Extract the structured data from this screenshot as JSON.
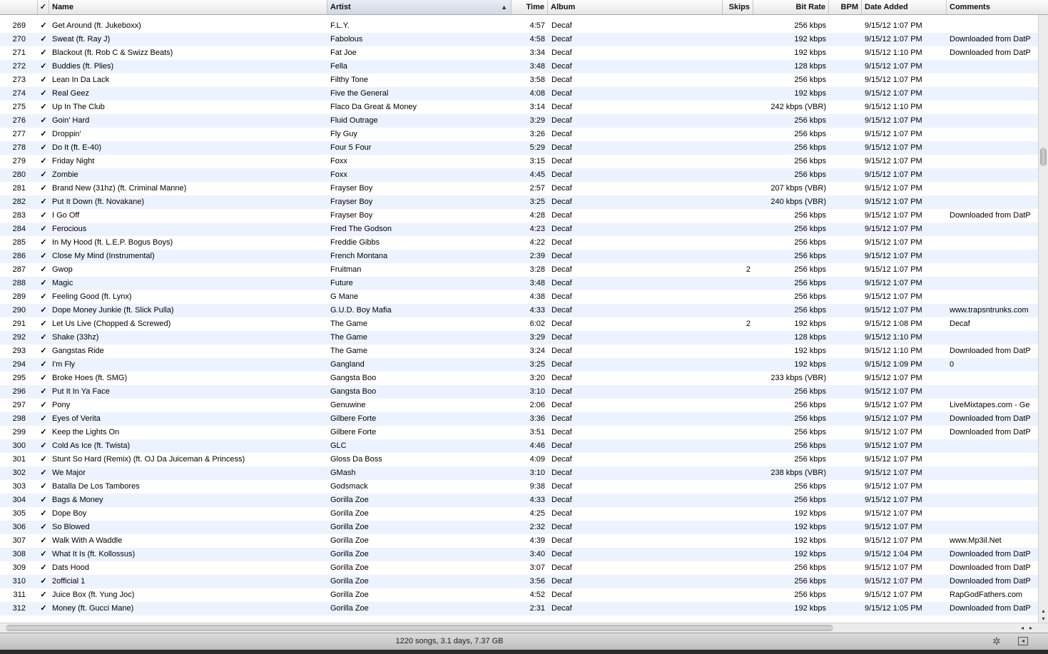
{
  "columns": {
    "check": "✓",
    "name": "Name",
    "artist": "Artist",
    "time": "Time",
    "album": "Album",
    "skips": "Skips",
    "bitrate": "Bit Rate",
    "bpm": "BPM",
    "date_added": "Date Added",
    "comments": "Comments",
    "sort_arrow": "▲"
  },
  "sorted_column": "artist",
  "rows": [
    {
      "num": "269",
      "check": "✓",
      "name": "Get Around (ft. Jukeboxx)",
      "artist": "F.L.Y.",
      "time": "4:57",
      "album": "Decaf",
      "skips": "",
      "bitrate": "256 kbps",
      "bpm": "",
      "date": "9/15/12 1:07 PM",
      "comments": ""
    },
    {
      "num": "270",
      "check": "✓",
      "name": "Sweat (ft. Ray J)",
      "artist": "Fabolous",
      "time": "4:58",
      "album": "Decaf",
      "skips": "",
      "bitrate": "192 kbps",
      "bpm": "",
      "date": "9/15/12 1:07 PM",
      "comments": "Downloaded from DatP"
    },
    {
      "num": "271",
      "check": "✓",
      "name": "Blackout (ft. Rob C & Swizz Beats)",
      "artist": "Fat Joe",
      "time": "3:34",
      "album": "Decaf",
      "skips": "",
      "bitrate": "192 kbps",
      "bpm": "",
      "date": "9/15/12 1:10 PM",
      "comments": "Downloaded from DatP"
    },
    {
      "num": "272",
      "check": "✓",
      "name": "Buddies (ft. Plies)",
      "artist": "Fella",
      "time": "3:48",
      "album": "Decaf",
      "skips": "",
      "bitrate": "128 kbps",
      "bpm": "",
      "date": "9/15/12 1:07 PM",
      "comments": ""
    },
    {
      "num": "273",
      "check": "✓",
      "name": "Lean In Da Lack",
      "artist": "Filthy Tone",
      "time": "3:58",
      "album": "Decaf",
      "skips": "",
      "bitrate": "256 kbps",
      "bpm": "",
      "date": "9/15/12 1:07 PM",
      "comments": ""
    },
    {
      "num": "274",
      "check": "✓",
      "name": "Real Geez",
      "artist": "Five the General",
      "time": "4:08",
      "album": "Decaf",
      "skips": "",
      "bitrate": "192 kbps",
      "bpm": "",
      "date": "9/15/12 1:07 PM",
      "comments": ""
    },
    {
      "num": "275",
      "check": "✓",
      "name": "Up In The Club",
      "artist": "Flaco Da Great & Money",
      "time": "3:14",
      "album": "Decaf",
      "skips": "",
      "bitrate": "242 kbps (VBR)",
      "bpm": "",
      "date": "9/15/12 1:10 PM",
      "comments": ""
    },
    {
      "num": "276",
      "check": "✓",
      "name": "Goin' Hard",
      "artist": "Fluid Outrage",
      "time": "3:29",
      "album": "Decaf",
      "skips": "",
      "bitrate": "256 kbps",
      "bpm": "",
      "date": "9/15/12 1:07 PM",
      "comments": ""
    },
    {
      "num": "277",
      "check": "✓",
      "name": "Droppin'",
      "artist": "Fly Guy",
      "time": "3:26",
      "album": "Decaf",
      "skips": "",
      "bitrate": "256 kbps",
      "bpm": "",
      "date": "9/15/12 1:07 PM",
      "comments": ""
    },
    {
      "num": "278",
      "check": "✓",
      "name": "Do It (ft. E-40)",
      "artist": "Four 5 Four",
      "time": "5:29",
      "album": "Decaf",
      "skips": "",
      "bitrate": "256 kbps",
      "bpm": "",
      "date": "9/15/12 1:07 PM",
      "comments": ""
    },
    {
      "num": "279",
      "check": "✓",
      "name": "Friday Night",
      "artist": "Foxx",
      "time": "3:15",
      "album": "Decaf",
      "skips": "",
      "bitrate": "256 kbps",
      "bpm": "",
      "date": "9/15/12 1:07 PM",
      "comments": ""
    },
    {
      "num": "280",
      "check": "✓",
      "name": "Zombie",
      "artist": "Foxx",
      "time": "4:45",
      "album": "Decaf",
      "skips": "",
      "bitrate": "256 kbps",
      "bpm": "",
      "date": "9/15/12 1:07 PM",
      "comments": ""
    },
    {
      "num": "281",
      "check": "✓",
      "name": "Brand New (31hz) (ft. Criminal Manne)",
      "artist": "Frayser Boy",
      "time": "2:57",
      "album": "Decaf",
      "skips": "",
      "bitrate": "207 kbps (VBR)",
      "bpm": "",
      "date": "9/15/12 1:07 PM",
      "comments": ""
    },
    {
      "num": "282",
      "check": "✓",
      "name": "Put It Down (ft. Novakane)",
      "artist": "Frayser Boy",
      "time": "3:25",
      "album": "Decaf",
      "skips": "",
      "bitrate": "240 kbps (VBR)",
      "bpm": "",
      "date": "9/15/12 1:07 PM",
      "comments": ""
    },
    {
      "num": "283",
      "check": "✓",
      "name": "I Go Off",
      "artist": "Frayser Boy",
      "time": "4:28",
      "album": "Decaf",
      "skips": "",
      "bitrate": "256 kbps",
      "bpm": "",
      "date": "9/15/12 1:07 PM",
      "comments": "Downloaded from DatP"
    },
    {
      "num": "284",
      "check": "✓",
      "name": "Ferocious",
      "artist": "Fred The Godson",
      "time": "4:23",
      "album": "Decaf",
      "skips": "",
      "bitrate": "256 kbps",
      "bpm": "",
      "date": "9/15/12 1:07 PM",
      "comments": ""
    },
    {
      "num": "285",
      "check": "✓",
      "name": "In My Hood (ft. L.E.P. Bogus Boys)",
      "artist": "Freddie Gibbs",
      "time": "4:22",
      "album": "Decaf",
      "skips": "",
      "bitrate": "256 kbps",
      "bpm": "",
      "date": "9/15/12 1:07 PM",
      "comments": ""
    },
    {
      "num": "286",
      "check": "✓",
      "name": "Close My Mind (Instrumental)",
      "artist": "French Montana",
      "time": "2:39",
      "album": "Decaf",
      "skips": "",
      "bitrate": "256 kbps",
      "bpm": "",
      "date": "9/15/12 1:07 PM",
      "comments": ""
    },
    {
      "num": "287",
      "check": "✓",
      "name": "Gwop",
      "artist": "Fruitman",
      "time": "3:28",
      "album": "Decaf",
      "skips": "2",
      "bitrate": "256 kbps",
      "bpm": "",
      "date": "9/15/12 1:07 PM",
      "comments": ""
    },
    {
      "num": "288",
      "check": "✓",
      "name": "Magic",
      "artist": "Future",
      "time": "3:48",
      "album": "Decaf",
      "skips": "",
      "bitrate": "256 kbps",
      "bpm": "",
      "date": "9/15/12 1:07 PM",
      "comments": ""
    },
    {
      "num": "289",
      "check": "✓",
      "name": "Feeling Good (ft. Lynx)",
      "artist": "G Mane",
      "time": "4:38",
      "album": "Decaf",
      "skips": "",
      "bitrate": "256 kbps",
      "bpm": "",
      "date": "9/15/12 1:07 PM",
      "comments": ""
    },
    {
      "num": "290",
      "check": "✓",
      "name": "Dope Money Junkie (ft. Slick Pulla)",
      "artist": "G.U.D. Boy Mafia",
      "time": "4:33",
      "album": "Decaf",
      "skips": "",
      "bitrate": "256 kbps",
      "bpm": "",
      "date": "9/15/12 1:07 PM",
      "comments": "www.trapsntrunks.com"
    },
    {
      "num": "291",
      "check": "✓",
      "name": "Let Us Live (Chopped & Screwed)",
      "artist": "The Game",
      "time": "6:02",
      "album": "Decaf",
      "skips": "2",
      "bitrate": "192 kbps",
      "bpm": "",
      "date": "9/15/12 1:08 PM",
      "comments": "Decaf"
    },
    {
      "num": "292",
      "check": "✓",
      "name": "Shake (33hz)",
      "artist": "The Game",
      "time": "3:29",
      "album": "Decaf",
      "skips": "",
      "bitrate": "128 kbps",
      "bpm": "",
      "date": "9/15/12 1:10 PM",
      "comments": ""
    },
    {
      "num": "293",
      "check": "✓",
      "name": "Gangstas Ride",
      "artist": "The Game",
      "time": "3:24",
      "album": "Decaf",
      "skips": "",
      "bitrate": "192 kbps",
      "bpm": "",
      "date": "9/15/12 1:10 PM",
      "comments": "Downloaded from DatP"
    },
    {
      "num": "294",
      "check": "✓",
      "name": "I'm Fly",
      "artist": "Gangland",
      "time": "3:25",
      "album": "Decaf",
      "skips": "",
      "bitrate": "192 kbps",
      "bpm": "",
      "date": "9/15/12 1:09 PM",
      "comments": "0"
    },
    {
      "num": "295",
      "check": "✓",
      "name": "Broke Hoes (ft. SMG)",
      "artist": "Gangsta Boo",
      "time": "3:20",
      "album": "Decaf",
      "skips": "",
      "bitrate": "233 kbps (VBR)",
      "bpm": "",
      "date": "9/15/12 1:07 PM",
      "comments": ""
    },
    {
      "num": "296",
      "check": "✓",
      "name": "Put It In Ya Face",
      "artist": "Gangsta Boo",
      "time": "3:10",
      "album": "Decaf",
      "skips": "",
      "bitrate": "256 kbps",
      "bpm": "",
      "date": "9/15/12 1:07 PM",
      "comments": ""
    },
    {
      "num": "297",
      "check": "✓",
      "name": "Pony",
      "artist": "Genuwine",
      "time": "2:06",
      "album": "Decaf",
      "skips": "",
      "bitrate": "256 kbps",
      "bpm": "",
      "date": "9/15/12 1:07 PM",
      "comments": "LiveMixtapes.com - Ge"
    },
    {
      "num": "298",
      "check": "✓",
      "name": "Eyes of Verita",
      "artist": "Gilbere Forte",
      "time": "3:36",
      "album": "Decaf",
      "skips": "",
      "bitrate": "256 kbps",
      "bpm": "",
      "date": "9/15/12 1:07 PM",
      "comments": "Downloaded from DatP"
    },
    {
      "num": "299",
      "check": "✓",
      "name": "Keep the Lights On",
      "artist": "Gilbere Forte",
      "time": "3:51",
      "album": "Decaf",
      "skips": "",
      "bitrate": "256 kbps",
      "bpm": "",
      "date": "9/15/12 1:07 PM",
      "comments": "Downloaded from DatP"
    },
    {
      "num": "300",
      "check": "✓",
      "name": "Cold As Ice (ft. Twista)",
      "artist": "GLC",
      "time": "4:46",
      "album": "Decaf",
      "skips": "",
      "bitrate": "256 kbps",
      "bpm": "",
      "date": "9/15/12 1:07 PM",
      "comments": ""
    },
    {
      "num": "301",
      "check": "✓",
      "name": "Stunt So Hard (Remix) (ft. OJ Da Juiceman & Princess)",
      "artist": "Gloss Da Boss",
      "time": "4:09",
      "album": "Decaf",
      "skips": "",
      "bitrate": "256 kbps",
      "bpm": "",
      "date": "9/15/12 1:07 PM",
      "comments": ""
    },
    {
      "num": "302",
      "check": "✓",
      "name": "We Major",
      "artist": "GMash",
      "time": "3:10",
      "album": "Decaf",
      "skips": "",
      "bitrate": "238 kbps (VBR)",
      "bpm": "",
      "date": "9/15/12 1:07 PM",
      "comments": ""
    },
    {
      "num": "303",
      "check": "✓",
      "name": "Batalla De Los Tambores",
      "artist": "Godsmack",
      "time": "9:38",
      "album": "Decaf",
      "skips": "",
      "bitrate": "256 kbps",
      "bpm": "",
      "date": "9/15/12 1:07 PM",
      "comments": ""
    },
    {
      "num": "304",
      "check": "✓",
      "name": "Bags & Money",
      "artist": "Gorilla Zoe",
      "time": "4:33",
      "album": "Decaf",
      "skips": "",
      "bitrate": "256 kbps",
      "bpm": "",
      "date": "9/15/12 1:07 PM",
      "comments": ""
    },
    {
      "num": "305",
      "check": "✓",
      "name": "Dope Boy",
      "artist": "Gorilla Zoe",
      "time": "4:25",
      "album": "Decaf",
      "skips": "",
      "bitrate": "192 kbps",
      "bpm": "",
      "date": "9/15/12 1:07 PM",
      "comments": ""
    },
    {
      "num": "306",
      "check": "✓",
      "name": "So Blowed",
      "artist": "Gorilla Zoe",
      "time": "2:32",
      "album": "Decaf",
      "skips": "",
      "bitrate": "192 kbps",
      "bpm": "",
      "date": "9/15/12 1:07 PM",
      "comments": ""
    },
    {
      "num": "307",
      "check": "✓",
      "name": "Walk With A Waddle",
      "artist": "Gorilla Zoe",
      "time": "4:39",
      "album": "Decaf",
      "skips": "",
      "bitrate": "192 kbps",
      "bpm": "",
      "date": "9/15/12 1:07 PM",
      "comments": "www.Mp3il.Net"
    },
    {
      "num": "308",
      "check": "✓",
      "name": "What It Is (ft. Kollossus)",
      "artist": "Gorilla Zoe",
      "time": "3:40",
      "album": "Decaf",
      "skips": "",
      "bitrate": "192 kbps",
      "bpm": "",
      "date": "9/15/12 1:04 PM",
      "comments": "Downloaded from DatP"
    },
    {
      "num": "309",
      "check": "✓",
      "name": "Dats Hood",
      "artist": "Gorilla Zoe",
      "time": "3:07",
      "album": "Decaf",
      "skips": "",
      "bitrate": "256 kbps",
      "bpm": "",
      "date": "9/15/12 1:07 PM",
      "comments": "Downloaded from DatP"
    },
    {
      "num": "310",
      "check": "✓",
      "name": "2official 1",
      "artist": "Gorilla Zoe",
      "time": "3:56",
      "album": "Decaf",
      "skips": "",
      "bitrate": "256 kbps",
      "bpm": "",
      "date": "9/15/12 1:07 PM",
      "comments": "Downloaded from DatP"
    },
    {
      "num": "311",
      "check": "✓",
      "name": "Juice Box (ft. Yung Joc)",
      "artist": "Gorilla Zoe",
      "time": "4:52",
      "album": "Decaf",
      "skips": "",
      "bitrate": "256 kbps",
      "bpm": "",
      "date": "9/15/12 1:07 PM",
      "comments": "RapGodFathers.com"
    },
    {
      "num": "312",
      "check": "✓",
      "name": "Money (ft. Gucci Mane)",
      "artist": "Gorilla Zoe",
      "time": "2:31",
      "album": "Decaf",
      "skips": "",
      "bitrate": "192 kbps",
      "bpm": "",
      "date": "9/15/12 1:05 PM",
      "comments": "Downloaded from DatP"
    }
  ],
  "status": {
    "summary": "1220 songs, 3.1 days, 7.37 GB"
  },
  "icons": {
    "gear": "gear-icon",
    "artwork_toggle": "artwork-toggle-icon",
    "scroll_left": "◂",
    "scroll_right": "▸",
    "scroll_up": "▴",
    "scroll_down": "▾",
    "gear_glyph": "✲",
    "toggle_glyph": "◂"
  },
  "colors": {
    "alt_row": "#edf3fe",
    "sorted_header": "#cfd8e4"
  }
}
